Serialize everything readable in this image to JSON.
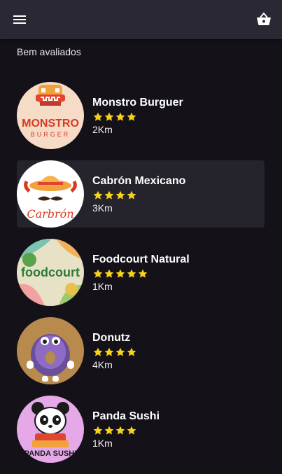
{
  "appbar": {
    "menu_icon": "menu-icon",
    "cart_icon": "shopping-basket-icon"
  },
  "section": {
    "title": "Bem avaliados"
  },
  "colors": {
    "star": "#f7d21b",
    "appbar": "#2a2832",
    "background": "#141218"
  },
  "restaurants": [
    {
      "name": "Monstro Burguer",
      "rating": 4,
      "distance": "2Km",
      "logo": {
        "line1": "MONSTRO",
        "line2": "BURGER"
      }
    },
    {
      "name": "Cabrón Mexicano",
      "rating": 4,
      "distance": "3Km",
      "logo": {
        "line1": "Carbrón"
      }
    },
    {
      "name": "Foodcourt Natural",
      "rating": 5,
      "distance": "1Km",
      "logo": {
        "line1": "foodcourt"
      }
    },
    {
      "name": "Donutz",
      "rating": 4,
      "distance": "4Km"
    },
    {
      "name": "Panda Sushi",
      "rating": 4,
      "distance": "1Km",
      "logo": {
        "line1": "PANDA SUSHI"
      }
    }
  ]
}
